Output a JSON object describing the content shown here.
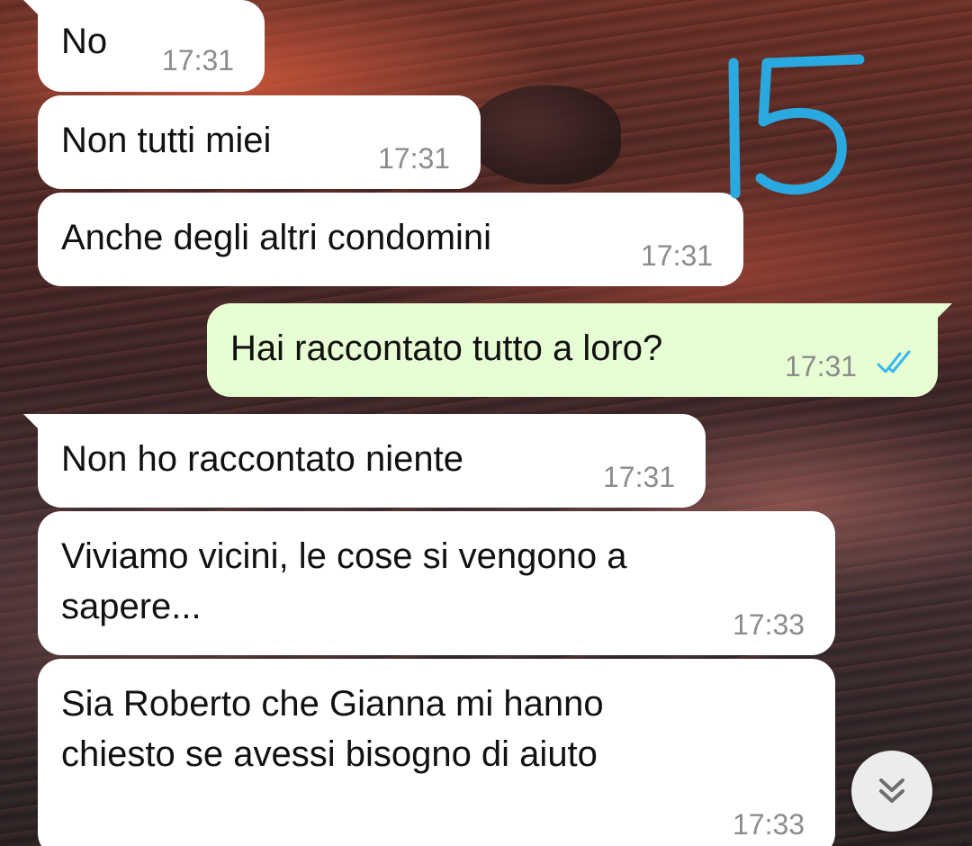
{
  "chat": {
    "messages": [
      {
        "text": "No",
        "time": "17:31",
        "direction": "incoming"
      },
      {
        "text": "Non tutti miei",
        "time": "17:31",
        "direction": "incoming"
      },
      {
        "text": "Anche degli altri condomini",
        "time": "17:31",
        "direction": "incoming"
      },
      {
        "text": "Hai raccontato tutto a loro?",
        "time": "17:31",
        "direction": "outgoing",
        "status": "read"
      },
      {
        "text": "Non ho raccontato niente",
        "time": "17:31",
        "direction": "incoming"
      },
      {
        "text": "Viviamo vicini, le cose si vengono a\nsapere...",
        "time": "17:33",
        "direction": "incoming"
      },
      {
        "text": "Sia Roberto che Gianna mi hanno\nchiesto se avessi bisogno di aiuto",
        "time": "17:33",
        "direction": "incoming"
      }
    ]
  },
  "annotation": {
    "text": "15",
    "color": "#2aa8e0"
  },
  "colors": {
    "incoming_bubble": "#ffffff",
    "outgoing_bubble": "#e7fdd3",
    "read_ticks": "#34b7f1",
    "timestamp": "#8c8c8c"
  },
  "icons": {
    "read_status": "double-check-icon",
    "scroll_down": "double-chevron-down-icon"
  }
}
